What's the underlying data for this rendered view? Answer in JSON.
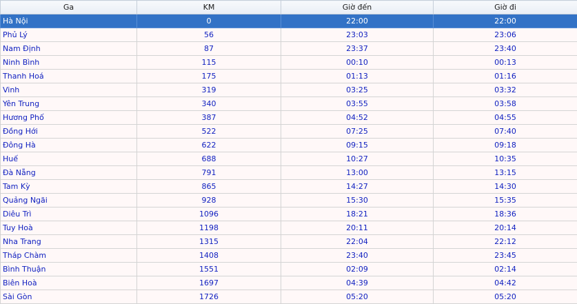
{
  "table": {
    "headers": [
      "Ga",
      "KM",
      "Giờ đến",
      "Giờ đi"
    ],
    "selected_index": 0,
    "rows": [
      {
        "station": "Hà Nội",
        "km": "0",
        "arrive": "22:00",
        "depart": "22:00"
      },
      {
        "station": "Phủ Lý",
        "km": "56",
        "arrive": "23:03",
        "depart": "23:06"
      },
      {
        "station": "Nam Định",
        "km": "87",
        "arrive": "23:37",
        "depart": "23:40"
      },
      {
        "station": "Ninh Bình",
        "km": "115",
        "arrive": "00:10",
        "depart": "00:13"
      },
      {
        "station": "Thanh Hoá",
        "km": "175",
        "arrive": "01:13",
        "depart": "01:16"
      },
      {
        "station": "Vinh",
        "km": "319",
        "arrive": "03:25",
        "depart": "03:32"
      },
      {
        "station": "Yên Trung",
        "km": "340",
        "arrive": "03:55",
        "depart": "03:58"
      },
      {
        "station": "Hương Phố",
        "km": "387",
        "arrive": "04:52",
        "depart": "04:55"
      },
      {
        "station": "Đồng Hới",
        "km": "522",
        "arrive": "07:25",
        "depart": "07:40"
      },
      {
        "station": "Đông Hà",
        "km": "622",
        "arrive": "09:15",
        "depart": "09:18"
      },
      {
        "station": "Huế",
        "km": "688",
        "arrive": "10:27",
        "depart": "10:35"
      },
      {
        "station": "Đà Nẵng",
        "km": "791",
        "arrive": "13:00",
        "depart": "13:15"
      },
      {
        "station": "Tam Kỳ",
        "km": "865",
        "arrive": "14:27",
        "depart": "14:30"
      },
      {
        "station": "Quảng Ngãi",
        "km": "928",
        "arrive": "15:30",
        "depart": "15:35"
      },
      {
        "station": "Diêu Trì",
        "km": "1096",
        "arrive": "18:21",
        "depart": "18:36"
      },
      {
        "station": "Tuy Hoà",
        "km": "1198",
        "arrive": "20:11",
        "depart": "20:14"
      },
      {
        "station": "Nha Trang",
        "km": "1315",
        "arrive": "22:04",
        "depart": "22:12"
      },
      {
        "station": "Tháp Chàm",
        "km": "1408",
        "arrive": "23:40",
        "depart": "23:45"
      },
      {
        "station": "Bình Thuận",
        "km": "1551",
        "arrive": "02:09",
        "depart": "02:14"
      },
      {
        "station": "Biên Hoà",
        "km": "1697",
        "arrive": "04:39",
        "depart": "04:42"
      },
      {
        "station": "Sài Gòn",
        "km": "1726",
        "arrive": "05:20",
        "depart": "05:20"
      }
    ]
  },
  "colors": {
    "selected_row_bg": "#3272c6",
    "row_bg": "#fff8f8",
    "text": "#1020c0"
  }
}
